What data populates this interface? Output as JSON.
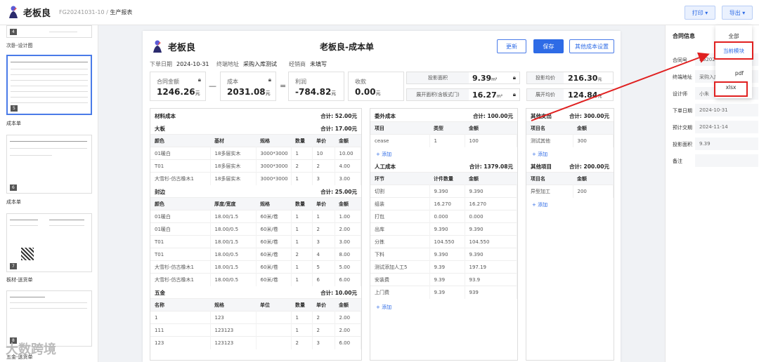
{
  "app": {
    "name": "老板良",
    "doc_id": "FG20241031-10",
    "breadcrumb_sep": " / ",
    "page": "生产报表"
  },
  "topbar": {
    "print_label": "打印 ▾",
    "export_label": "导出 ▾"
  },
  "thumbs": [
    {
      "num": "4",
      "label": "次卧-设计图"
    },
    {
      "num": "5",
      "label": "成本单"
    },
    {
      "num": "6",
      "label": "成本单"
    },
    {
      "num": "7",
      "label": "板材-送货单"
    },
    {
      "num": "8",
      "label": "五金-送货单"
    }
  ],
  "doc": {
    "logo_text": "老板良",
    "title": "老板良-成本单",
    "buttons": {
      "update": "更新",
      "save": "保存",
      "other_cost": "其他成本设置"
    },
    "meta": {
      "order_date_label": "下单日期",
      "order_date": "2024-10-31",
      "terminal_label": "终端地址",
      "terminal": "采购入库测试",
      "dealer_label": "经销商",
      "dealer": "未填写"
    },
    "summary": {
      "contract_label": "合同金额",
      "contract": "1246.26",
      "cost_label": "成本",
      "cost": "2031.08",
      "profit_label": "利润",
      "profit": "-784.82",
      "receipt_label": "收款",
      "receipt": "0.00",
      "unit_yuan": "元",
      "minus": "—",
      "equals": "=",
      "proj_area_label": "投影面积",
      "proj_area": "9.39",
      "unit_m2": "m²",
      "unfold_area_label": "展开面积(含板式门)",
      "unfold_area": "16.27",
      "proj_avg_label": "投影均价",
      "proj_avg": "216.30",
      "unfold_avg_label": "展开均价",
      "unfold_avg": "124.84"
    },
    "material": {
      "title": "材料成本",
      "total": "合计: 52.00元",
      "board": {
        "title": "大板",
        "total": "合计: 17.00元",
        "headers": [
          "颜色",
          "基材",
          "规格",
          "数量",
          "单价",
          "金额"
        ],
        "rows": [
          [
            "01暖白",
            "18多层实木",
            "3000*3000",
            "1",
            "10",
            "10.00"
          ],
          [
            "T01",
            "18多层实木",
            "3000*3000",
            "2",
            "2",
            "4.00"
          ],
          [
            "大雪杉-仿古橡木1",
            "18多层实木",
            "3000*3000",
            "1",
            "3",
            "3.00"
          ]
        ]
      },
      "edge": {
        "title": "封边",
        "total": "合计: 25.00元",
        "headers": [
          "颜色",
          "厚度/宽度",
          "规格",
          "数量",
          "单价",
          "金额"
        ],
        "rows": [
          [
            "01暖白",
            "18.00/1.5",
            "60米/卷",
            "1",
            "1",
            "1.00"
          ],
          [
            "01暖白",
            "18.00/0.5",
            "60米/卷",
            "1",
            "2",
            "2.00"
          ],
          [
            "T01",
            "18.00/1.5",
            "60米/卷",
            "1",
            "3",
            "3.00"
          ],
          [
            "T01",
            "18.00/0.5",
            "60米/卷",
            "2",
            "4",
            "8.00"
          ],
          [
            "大雪杉-仿古橡木1",
            "18.00/1.5",
            "60米/卷",
            "1",
            "5",
            "5.00"
          ],
          [
            "大雪杉-仿古橡木1",
            "18.00/0.5",
            "60米/卷",
            "1",
            "6",
            "6.00"
          ]
        ]
      },
      "hardware": {
        "title": "五金",
        "total": "合计: 10.00元",
        "headers": [
          "名称",
          "规格",
          "单位",
          "数量",
          "单价",
          "金额"
        ],
        "rows": [
          [
            "1",
            "123",
            "",
            "1",
            "2",
            "2.00"
          ],
          [
            "111",
            "123123",
            "",
            "1",
            "2",
            "2.00"
          ],
          [
            "123",
            "123123",
            "",
            "2",
            "3",
            "6.00"
          ]
        ]
      }
    },
    "outsource": {
      "title": "委外成本",
      "total": "合计: 100.00元",
      "headers": [
        "项目",
        "类型",
        "金额"
      ],
      "rows": [
        [
          "cease",
          "1",
          "100"
        ]
      ],
      "add": "+ 添加"
    },
    "labor": {
      "title": "人工成本",
      "total": "合计: 1379.08元",
      "headers": [
        "环节",
        "计件数量",
        "金额"
      ],
      "rows": [
        [
          "切割",
          "9.390",
          "9.390"
        ],
        [
          "组装",
          "16.270",
          "16.270"
        ],
        [
          "打包",
          "0.000",
          "0.000"
        ],
        [
          "出库",
          "9.390",
          "9.390"
        ],
        [
          "分拣",
          "104.550",
          "104.550"
        ],
        [
          "下料",
          "9.390",
          "9.390"
        ],
        [
          "测试添加人工5",
          "9.39",
          "197.19"
        ],
        [
          "安装费",
          "9.39",
          "93.9"
        ],
        [
          "上门费",
          "9.39",
          "939"
        ]
      ],
      "add": "+ 添加"
    },
    "other_expense": {
      "title": "其他支出",
      "total": "合计: 300.00元",
      "headers": [
        "项目名",
        "金额"
      ],
      "rows": [
        [
          "测试其他",
          "300"
        ]
      ],
      "add": "+ 添加"
    },
    "other_items": {
      "title": "其他项目",
      "total": "合计: 200.00元",
      "headers": [
        "项目名",
        "金额"
      ],
      "rows": [
        [
          "异型加工",
          "200"
        ]
      ],
      "add": "+ 添加"
    }
  },
  "rpanel": {
    "title": "合同信息",
    "rows": [
      {
        "label": "合同号",
        "value": "FG202"
      },
      {
        "label": "终端地址",
        "value": "采购入库"
      },
      {
        "label": "设计师",
        "value": "小朱"
      },
      {
        "label": "下单日期",
        "value": "2024-10-31"
      },
      {
        "label": "预计交期",
        "value": "2024-11-14"
      },
      {
        "label": "投影面积",
        "value": "9.39"
      },
      {
        "label": "备注",
        "value": ""
      }
    ]
  },
  "dropdown": {
    "all": "全部",
    "current": "当前模块",
    "pdf": "pdf",
    "xlsx": "xlsx"
  },
  "watermark": "大数跨境",
  "colors": {
    "primary": "#2e6be6",
    "highlight_box": "#e02020"
  }
}
